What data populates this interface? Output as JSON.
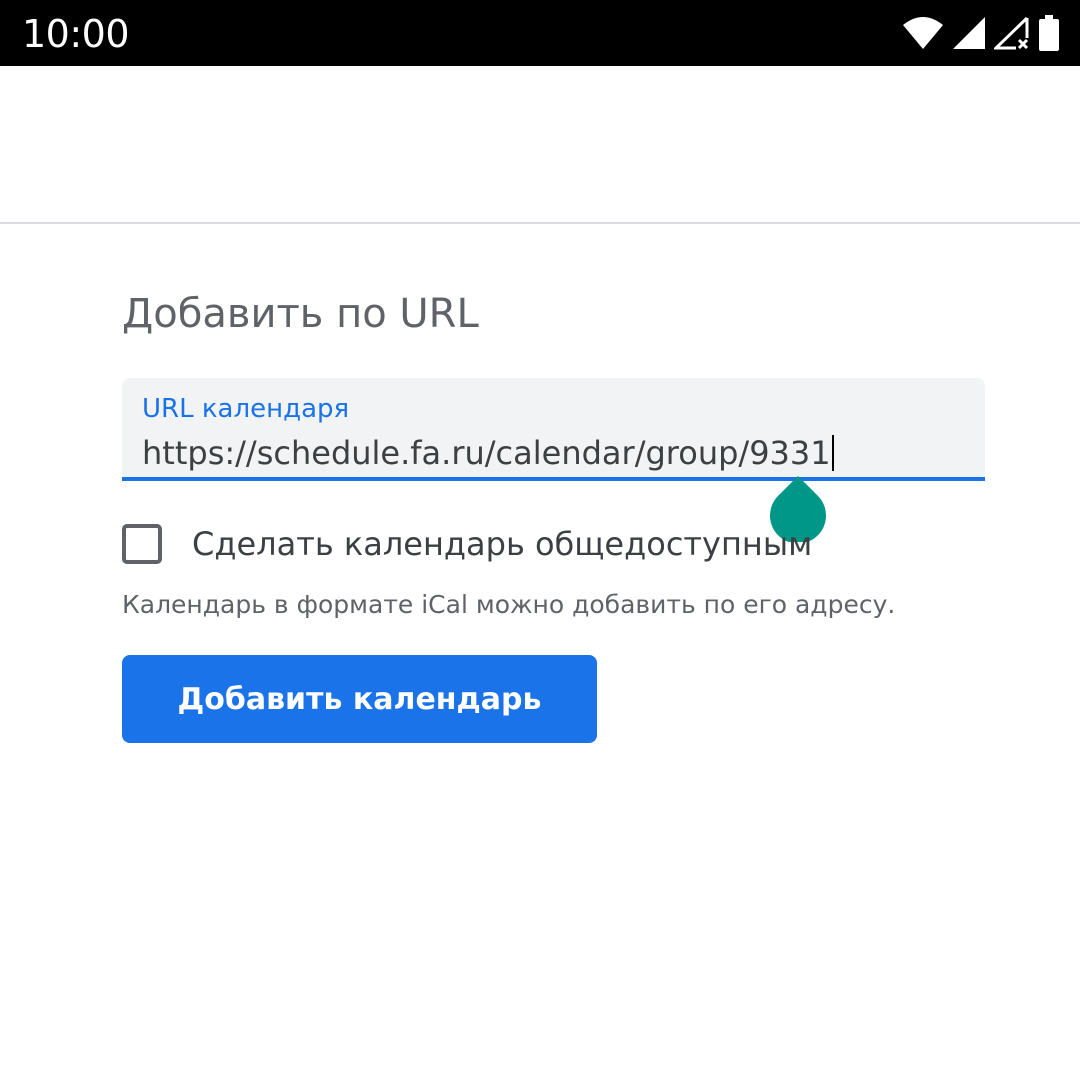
{
  "status_bar": {
    "time": "10:00",
    "icons": [
      "wifi-icon",
      "cell-signal-icon",
      "no-data-signal-icon",
      "battery-icon"
    ]
  },
  "form": {
    "title": "Добавить по URL",
    "url_field": {
      "label": "URL календаря",
      "value": "https://schedule.fa.ru/calendar/group/9331"
    },
    "public_checkbox": {
      "label": "Сделать календарь общедоступным",
      "checked": false
    },
    "hint": "Календарь в формате iCal можно добавить по его адресу.",
    "submit_label": "Добавить календарь"
  },
  "colors": {
    "accent": "#1a73e8",
    "field_bg": "#f1f3f4",
    "cursor_handle": "#009688",
    "text_primary": "#3c4043",
    "text_secondary": "#5f6368"
  }
}
